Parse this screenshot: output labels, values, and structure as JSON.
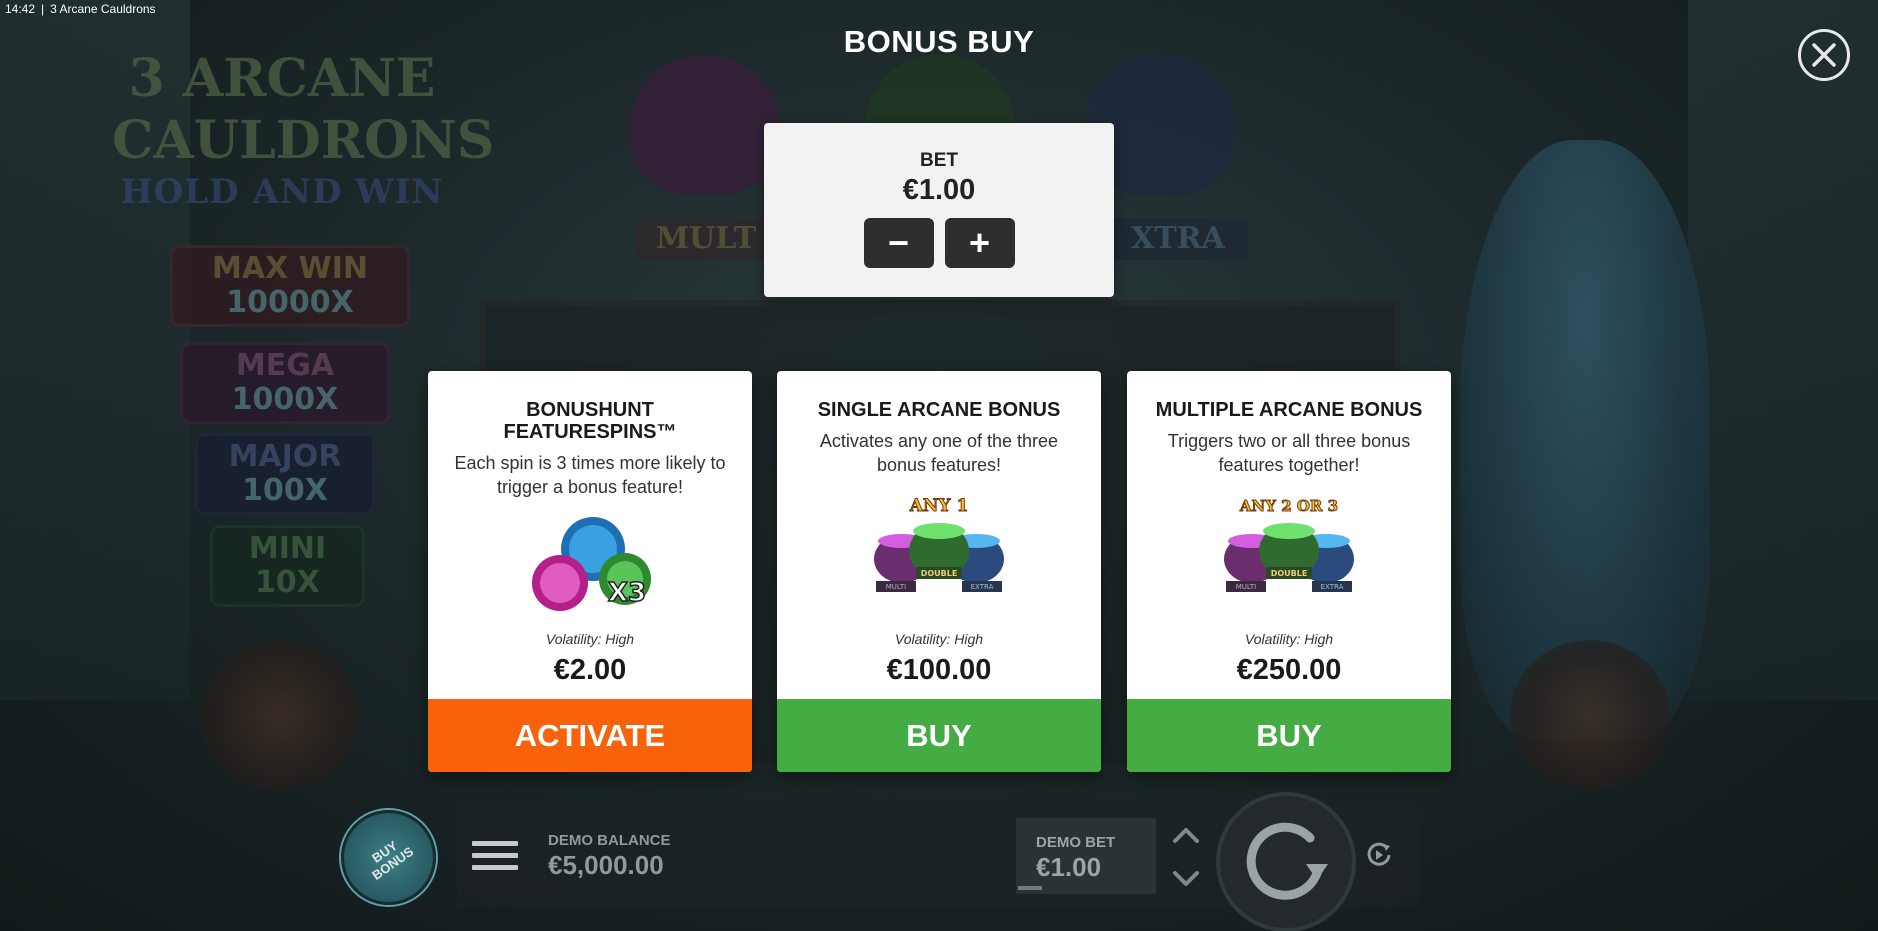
{
  "window": {
    "time": "14:42",
    "separator": "|",
    "title": "3 Arcane Cauldrons"
  },
  "background": {
    "logo_line1": "3 ARCANE",
    "logo_line2": "CAULDRONS",
    "logo_line3": "HOLD AND WIN",
    "jackpots": [
      {
        "name": "MAX WIN",
        "value": "10000X"
      },
      {
        "name": "MEGA",
        "value": "1000X"
      },
      {
        "name": "MAJOR",
        "value": "100X"
      },
      {
        "name": "MINI",
        "value": "10X"
      }
    ],
    "label_multi": "MULT",
    "label_extra": "XTRA"
  },
  "modal": {
    "title": "BONUS BUY",
    "close_icon": "close-icon"
  },
  "bet": {
    "label": "BET",
    "value": "€1.00",
    "minus": "−",
    "plus": "+"
  },
  "cards": [
    {
      "title": "BONUSHUNT FEATURESPINS™",
      "description": "Each spin is 3 times more likely to trigger a bonus feature!",
      "art_label": "X3",
      "volatility": "Volatility: High",
      "price": "€2.00",
      "button": "ACTIVATE",
      "button_color": "#f7620a"
    },
    {
      "title": "SINGLE ARCANE BONUS",
      "description": "Activates any one of the three bonus features!",
      "art_label": "ANY 1",
      "art_sub_left": "MULTI",
      "art_sub_mid": "DOUBLE",
      "art_sub_right": "EXTRA",
      "volatility": "Volatility: High",
      "price": "€100.00",
      "button": "BUY",
      "button_color": "#44ac43"
    },
    {
      "title": "MULTIPLE ARCANE BONUS",
      "description": "Triggers two or all three bonus features together!",
      "art_label": "ANY 2 OR 3",
      "art_sub_left": "MULTI",
      "art_sub_mid": "DOUBLE",
      "art_sub_right": "EXTRA",
      "volatility": "Volatility: High",
      "price": "€250.00",
      "button": "BUY",
      "button_color": "#44ac43"
    }
  ],
  "bottom": {
    "buy_bonus": "BUY BONUS",
    "balance_label": "DEMO BALANCE",
    "balance_value": "€5,000.00",
    "demo_bet_label": "DEMO BET",
    "demo_bet_value": "€1.00"
  }
}
